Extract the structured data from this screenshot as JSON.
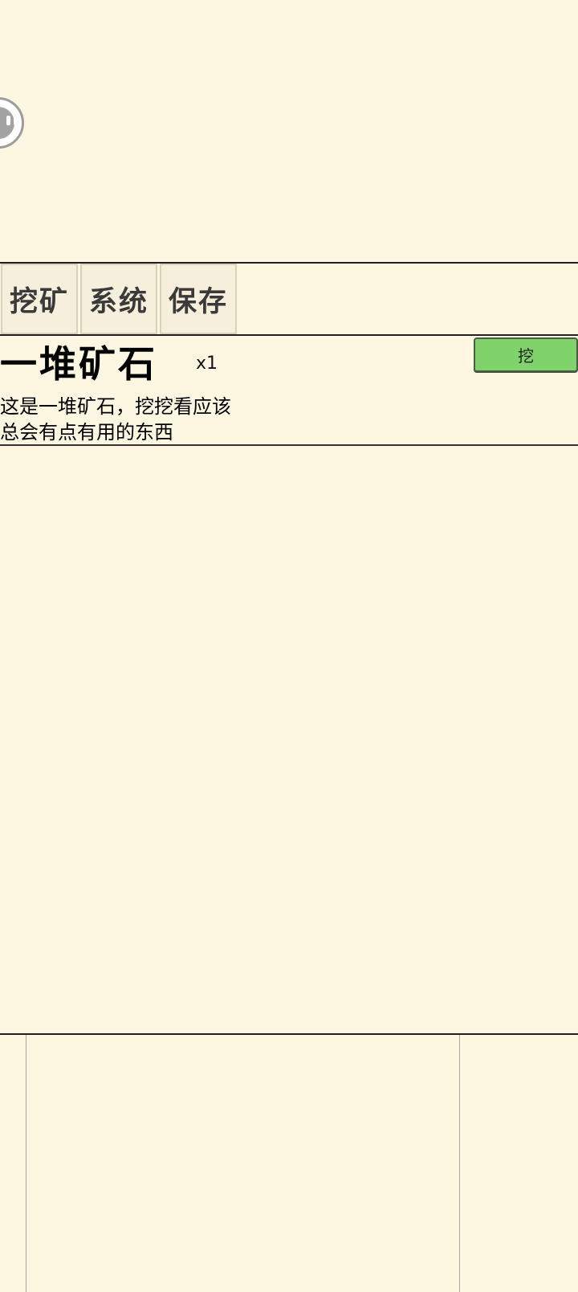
{
  "tabs": [
    {
      "label": "挖矿"
    },
    {
      "label": "系统"
    },
    {
      "label": "保存"
    }
  ],
  "item": {
    "name": "一堆矿石",
    "count": "x1",
    "description": "这是一堆矿石，挖挖看应该总会有点有用的东西",
    "action_label": "挖"
  },
  "colors": {
    "background": "#fdf7e1",
    "action_button": "#7fd36a"
  }
}
